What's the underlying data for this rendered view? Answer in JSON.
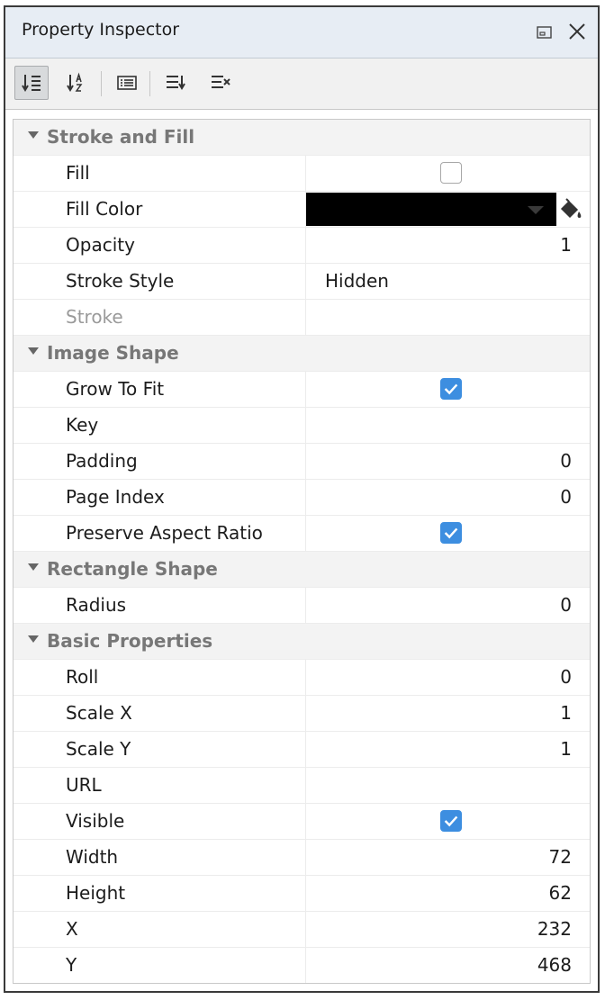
{
  "window": {
    "title": "Property Inspector"
  },
  "toolbar": {
    "buttons": [
      {
        "icon": "sort-by-category-icon",
        "active": true
      },
      {
        "icon": "sort-alphabetical-icon",
        "active": false
      },
      {
        "icon": "property-description-icon",
        "active": false
      },
      {
        "icon": "expand-all-icon",
        "active": false
      },
      {
        "icon": "collapse-all-icon",
        "active": false
      }
    ]
  },
  "colors": {
    "accent": "#3d8ee0",
    "fill_color_value": "#000000"
  },
  "categories": {
    "stroke_fill": {
      "label": "Stroke and Fill",
      "fill": {
        "label": "Fill",
        "checked": false
      },
      "fill_color": {
        "label": "Fill Color"
      },
      "opacity": {
        "label": "Opacity",
        "value": "1"
      },
      "stroke_style": {
        "label": "Stroke Style",
        "value": "Hidden"
      },
      "stroke": {
        "label": "Stroke"
      }
    },
    "image_shape": {
      "label": "Image Shape",
      "grow_to_fit": {
        "label": "Grow To Fit",
        "checked": true
      },
      "key": {
        "label": "Key"
      },
      "padding": {
        "label": "Padding",
        "value": "0"
      },
      "page_index": {
        "label": "Page Index",
        "value": "0"
      },
      "preserve_aspect": {
        "label": "Preserve Aspect Ratio",
        "checked": true
      }
    },
    "rectangle_shape": {
      "label": "Rectangle Shape",
      "radius": {
        "label": "Radius",
        "value": "0"
      }
    },
    "basic": {
      "label": "Basic Properties",
      "roll": {
        "label": "Roll",
        "value": "0"
      },
      "scale_x": {
        "label": "Scale X",
        "value": "1"
      },
      "scale_y": {
        "label": "Scale Y",
        "value": "1"
      },
      "url": {
        "label": "URL"
      },
      "visible": {
        "label": "Visible",
        "checked": true
      },
      "width": {
        "label": "Width",
        "value": "72"
      },
      "height": {
        "label": "Height",
        "value": "62"
      },
      "x": {
        "label": "X",
        "value": "232"
      },
      "y": {
        "label": "Y",
        "value": "468"
      }
    }
  }
}
